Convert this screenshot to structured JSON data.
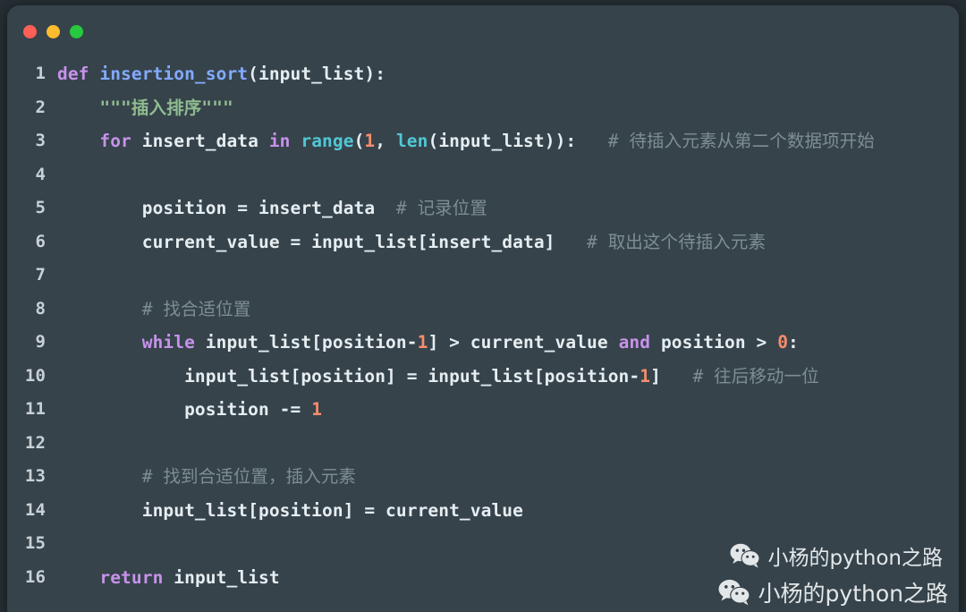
{
  "window": {
    "title_bar": {
      "buttons": [
        {
          "name": "close-button",
          "label": "",
          "color": "#ff5f56"
        },
        {
          "name": "minimize-button",
          "label": "",
          "color": "#febc2e"
        },
        {
          "name": "maximize-button",
          "label": "",
          "color": "#27c93f"
        }
      ]
    },
    "background_color": "#36434b",
    "page_background": "#252e33"
  },
  "editor": {
    "language": "python",
    "lines": [
      {
        "number": "1",
        "text": "def insertion_sort(input_list):"
      },
      {
        "number": "2",
        "text": "    \"\"\"插入排序\"\"\""
      },
      {
        "number": "3",
        "text": "    for insert_data in range(1, len(input_list)):   # 待插入元素从第二个数据项开始"
      },
      {
        "number": "4",
        "text": ""
      },
      {
        "number": "5",
        "text": "        position = insert_data  # 记录位置"
      },
      {
        "number": "6",
        "text": "        current_value = input_list[insert_data]   # 取出这个待插入元素"
      },
      {
        "number": "7",
        "text": ""
      },
      {
        "number": "8",
        "text": "        # 找合适位置"
      },
      {
        "number": "9",
        "text": "        while input_list[position-1] > current_value and position > 0:"
      },
      {
        "number": "10",
        "text": "            input_list[position] = input_list[position-1]   # 往后移动一位"
      },
      {
        "number": "11",
        "text": "            position -= 1"
      },
      {
        "number": "12",
        "text": ""
      },
      {
        "number": "13",
        "text": "        # 找到合适位置，插入元素"
      },
      {
        "number": "14",
        "text": "        input_list[position] = current_value"
      },
      {
        "number": "15",
        "text": ""
      },
      {
        "number": "16",
        "text": "    return input_list"
      }
    ],
    "wrapped_fragment": "始",
    "comments": {
      "line3": "# 待插入元素从第二个数据项开始",
      "line5": "# 记录位置",
      "line6": "# 取出这个待插入元素",
      "line8": "# 找合适位置",
      "line10": "# 往后移动一位",
      "line13": "# 找到合适位置，插入元素"
    },
    "colors": {
      "keyword": "#c792ea",
      "function": "#82aaff",
      "builtin": "#52c7d4",
      "number": "#f78c6c",
      "string": "#8fbc8f",
      "comment": "#8b9aa1",
      "plain": "#e6edf0",
      "line_number": "#c9d1d5"
    }
  },
  "watermarks": [
    {
      "icon": "wechat-icon",
      "text": "小杨的python之路"
    },
    {
      "icon": "wechat-icon",
      "text": "小杨的python之路"
    }
  ]
}
